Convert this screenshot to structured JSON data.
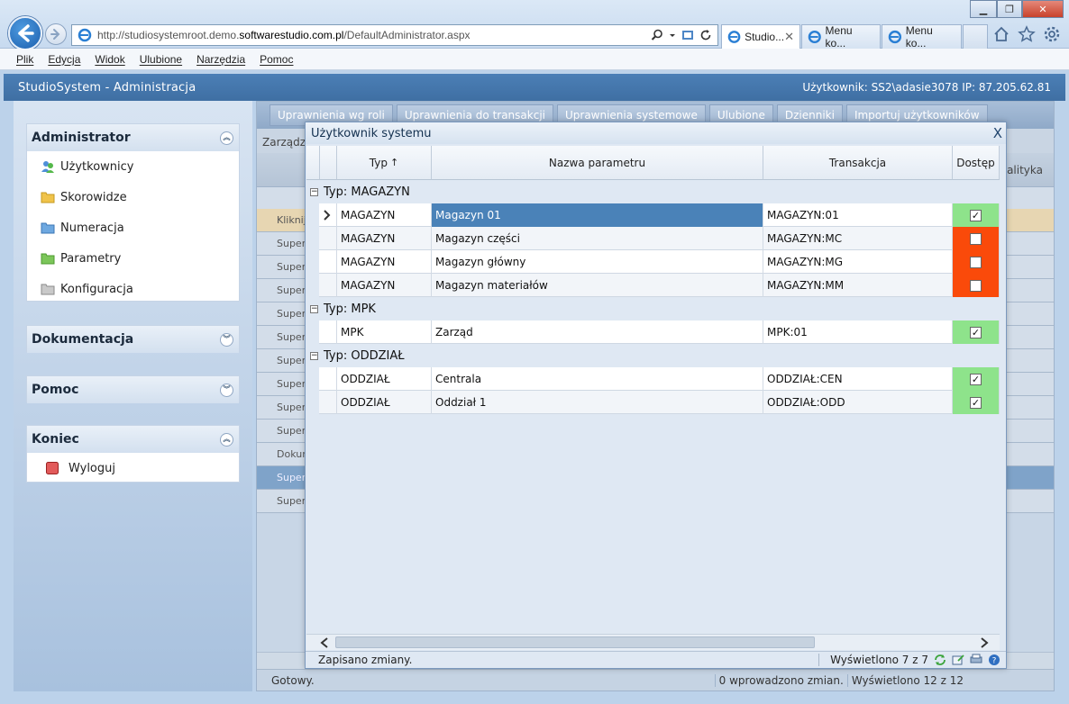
{
  "browser": {
    "url_prefix": "http://studiosystemroot.demo.",
    "url_domain": "softwarestudio.com.pl",
    "url_suffix": "/DefaultAdministrator.aspx",
    "tabs": [
      {
        "label": "Studio..."
      },
      {
        "label": "Menu ko..."
      },
      {
        "label": "Menu ko..."
      }
    ],
    "tab_close": "✕",
    "window_buttons": {
      "minimize": "▁",
      "maximize": "❐",
      "close": "✕"
    }
  },
  "menu": [
    "Plik",
    "Edycja",
    "Widok",
    "Ulubione",
    "Narzędzia",
    "Pomoc"
  ],
  "app": {
    "title": "StudioSystem - Administracja",
    "user_info": "Użytkownik: SS2\\adasie3078 IP: 87.205.62.81"
  },
  "sidebar": {
    "panels": [
      {
        "title": "Administrator",
        "expanded": true,
        "items": [
          {
            "label": "Użytkownicy",
            "icon": "users-icon"
          },
          {
            "label": "Skorowidze",
            "icon": "folder-icon"
          },
          {
            "label": "Numeracja",
            "icon": "folder-icon"
          },
          {
            "label": "Parametry",
            "icon": "folder-icon"
          },
          {
            "label": "Konfiguracja",
            "icon": "folder-icon"
          }
        ]
      },
      {
        "title": "Dokumentacja",
        "expanded": false
      },
      {
        "title": "Pomoc",
        "expanded": false
      },
      {
        "title": "Koniec",
        "expanded": true,
        "items": [
          {
            "label": "Wyloguj",
            "icon": "logout-icon"
          }
        ]
      }
    ]
  },
  "main": {
    "toolbar": [
      "Uprawnienia wg roli",
      "Uprawnienia do transakcji",
      "Uprawnienia systemowe",
      "Ulubione",
      "Dzienniki",
      "Importuj użytkowników"
    ],
    "breadcrumb": "Zarządza",
    "header_right": "nalityka",
    "hint_row": "Kliknij",
    "rows": [
      "Super",
      "Super",
      "Super",
      "Super",
      "Super",
      "Super",
      "Super",
      "Super",
      "Super",
      "Dokum",
      "Super",
      "Super"
    ],
    "status": "Gotowy.",
    "changes": "0 wprowadzono zmian.",
    "count": "Wyświetlono 12 z 12"
  },
  "modal": {
    "title": "Użytkownik systemu",
    "close": "X",
    "columns": {
      "type": "Typ",
      "sort_arrow": "↑",
      "name": "Nazwa parametru",
      "transaction": "Transakcja",
      "access": "Dostęp"
    },
    "groups": [
      {
        "label": "Typ: MAGAZYN",
        "toggle": "−",
        "rows": [
          {
            "type": "MAGAZYN",
            "name": "Magazyn 01",
            "transaction": "MAGAZYN:01",
            "access": true,
            "selected": true
          },
          {
            "type": "MAGAZYN",
            "name": "Magazyn części",
            "transaction": "MAGAZYN:MC",
            "access": false
          },
          {
            "type": "MAGAZYN",
            "name": "Magazyn główny",
            "transaction": "MAGAZYN:MG",
            "access": false
          },
          {
            "type": "MAGAZYN",
            "name": "Magazyn materiałów",
            "transaction": "MAGAZYN:MM",
            "access": false
          }
        ]
      },
      {
        "label": "Typ: MPK",
        "toggle": "−",
        "rows": [
          {
            "type": "MPK",
            "name": "Zarząd",
            "transaction": "MPK:01",
            "access": true
          }
        ]
      },
      {
        "label": "Typ: ODDZIAŁ",
        "toggle": "−",
        "rows": [
          {
            "type": "ODDZIAŁ",
            "name": "Centrala",
            "transaction": "ODDZIAŁ:CEN",
            "access": true
          },
          {
            "type": "ODDZIAŁ",
            "name": "Oddział 1",
            "transaction": "ODDZIAŁ:ODD",
            "access": true
          }
        ]
      }
    ],
    "status": "Zapisano zmiany.",
    "count": "Wyświetlono 7 z 7",
    "check_mark": "✓"
  },
  "colors": {
    "access_on": "#8ee38b",
    "access_off": "#fa4a0a",
    "selected": "#4a82b8",
    "header": "#4178ae"
  }
}
